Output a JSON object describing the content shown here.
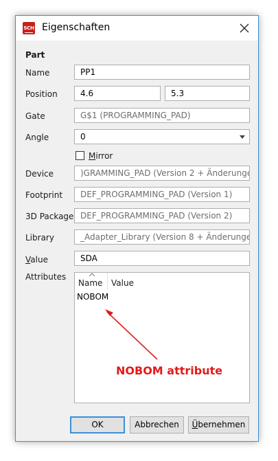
{
  "window": {
    "icon_text": "SCH",
    "title": "Eigenschaften"
  },
  "section": "Part",
  "fields": {
    "name": {
      "label": "Name",
      "value": "PP1"
    },
    "position": {
      "label": "Position",
      "x": "4.6",
      "y": "5.3"
    },
    "gate": {
      "label": "Gate",
      "value": "G$1 (PROGRAMMING_PAD)"
    },
    "angle": {
      "label": "Angle",
      "value": "0"
    },
    "mirror": {
      "label_prefix": "",
      "label_underlined": "M",
      "label_rest": "irror",
      "checked": false
    },
    "device": {
      "label": "Device",
      "value": ")GRAMMING_PAD (Version 2 + Änderungen)"
    },
    "footprint": {
      "label": "Footprint",
      "value": "DEF_PROGRAMMING_PAD (Version 1)"
    },
    "package3d": {
      "label": "3D Package",
      "value": "DEF_PROGRAMMING_PAD (Version 2)"
    },
    "library": {
      "label": "Library",
      "value": "_Adapter_Library (Version 8 + Änderungen)"
    },
    "value": {
      "label_underlined": "V",
      "label_rest": "alue",
      "value": "SDA"
    }
  },
  "attributes": {
    "label": "Attributes",
    "columns": [
      "Name",
      "Value"
    ],
    "rows": [
      {
        "name": "NOBOM",
        "value": ""
      }
    ],
    "annotation": "NOBOM attribute",
    "annotation_color": "#e31a1a"
  },
  "buttons": {
    "ok": "OK",
    "cancel": "Abbrechen",
    "apply_underlined": "Ü",
    "apply_rest": "bernehmen"
  },
  "colors": {
    "accent": "#3a8fd8",
    "app_icon": "#c81f1f"
  }
}
